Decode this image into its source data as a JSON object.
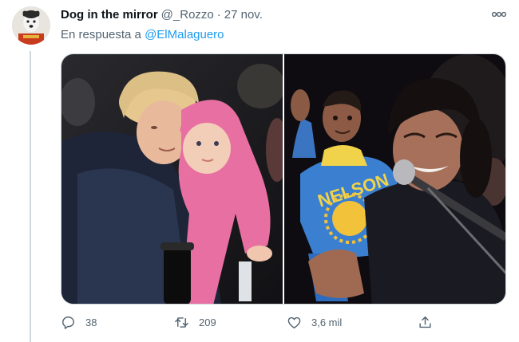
{
  "tweet": {
    "author": {
      "display_name": "Dog in the mirror",
      "handle": "@_Rozzo",
      "separator": "·",
      "date": "27 nov."
    },
    "reply_to": {
      "prefix": "En respuesta a",
      "mention": "@ElMalaguero"
    },
    "media": {
      "photos": [
        {
          "icon": "photo-woman-holding-baby"
        },
        {
          "icon": "photo-man-with-microphone",
          "shirt_text": "NELSON"
        }
      ]
    },
    "actions": {
      "replies": "38",
      "retweets": "209",
      "likes": "3,6 mil"
    }
  },
  "colors": {
    "text_primary": "#0f1419",
    "text_secondary": "#536471",
    "link": "#1d9bf0",
    "divider": "#cfd9de"
  }
}
